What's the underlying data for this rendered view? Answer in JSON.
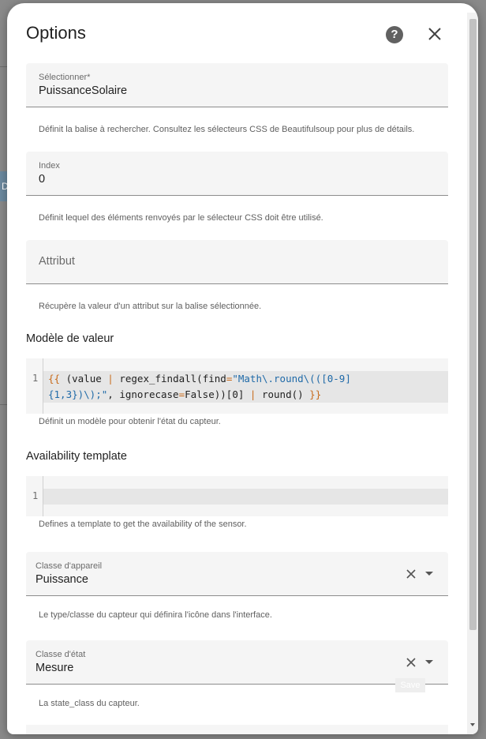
{
  "background": {
    "tab_label": "D"
  },
  "dialog": {
    "title": "Options",
    "help_icon": "help-circle-icon",
    "close_icon": "close-icon",
    "help_glyph": "?"
  },
  "fields": {
    "selector": {
      "label": "Sélectionner*",
      "value": "PuissanceSolaire",
      "helper": "Définit la balise à rechercher. Consultez les sélecteurs CSS de Beautifulsoup pour plus de détails."
    },
    "index": {
      "label": "Index",
      "value": "0",
      "helper": "Définit lequel des éléments renvoyés par le sélecteur CSS doit être utilisé."
    },
    "attribute": {
      "placeholder": "Attribut",
      "helper": "Récupère la valeur d'un attribut sur la balise sélectionnée."
    }
  },
  "value_template": {
    "title": "Modèle de valeur",
    "line_number": "1",
    "code_line1": [
      "{{",
      " (value ",
      "|",
      " regex_findall(find",
      "=",
      "\"Math\\.round\\(([0-9]",
      ""
    ],
    "code_line2": [
      "{1,3})\\);\"",
      ", ignorecase",
      "=",
      "False))[0] ",
      "|",
      " round() ",
      "}}"
    ],
    "helper": "Définit un modèle pour obtenir l'état du capteur."
  },
  "availability_template": {
    "title": "Availability template",
    "line_number": "1",
    "helper": "Defines a template to get the availability of the sensor."
  },
  "device_class": {
    "label": "Classe d'appareil",
    "value": "Puissance",
    "helper": "Le type/classe du capteur qui définira l'icône dans l'interface."
  },
  "state_class": {
    "label": "Classe d'état",
    "value": "Mesure",
    "helper": "La state_class du capteur."
  },
  "save_label": "Save",
  "colors": {
    "code_brace": "#c86a1a",
    "code_string": "#1f6aa8",
    "code_keyword": "#8a1f7a"
  }
}
